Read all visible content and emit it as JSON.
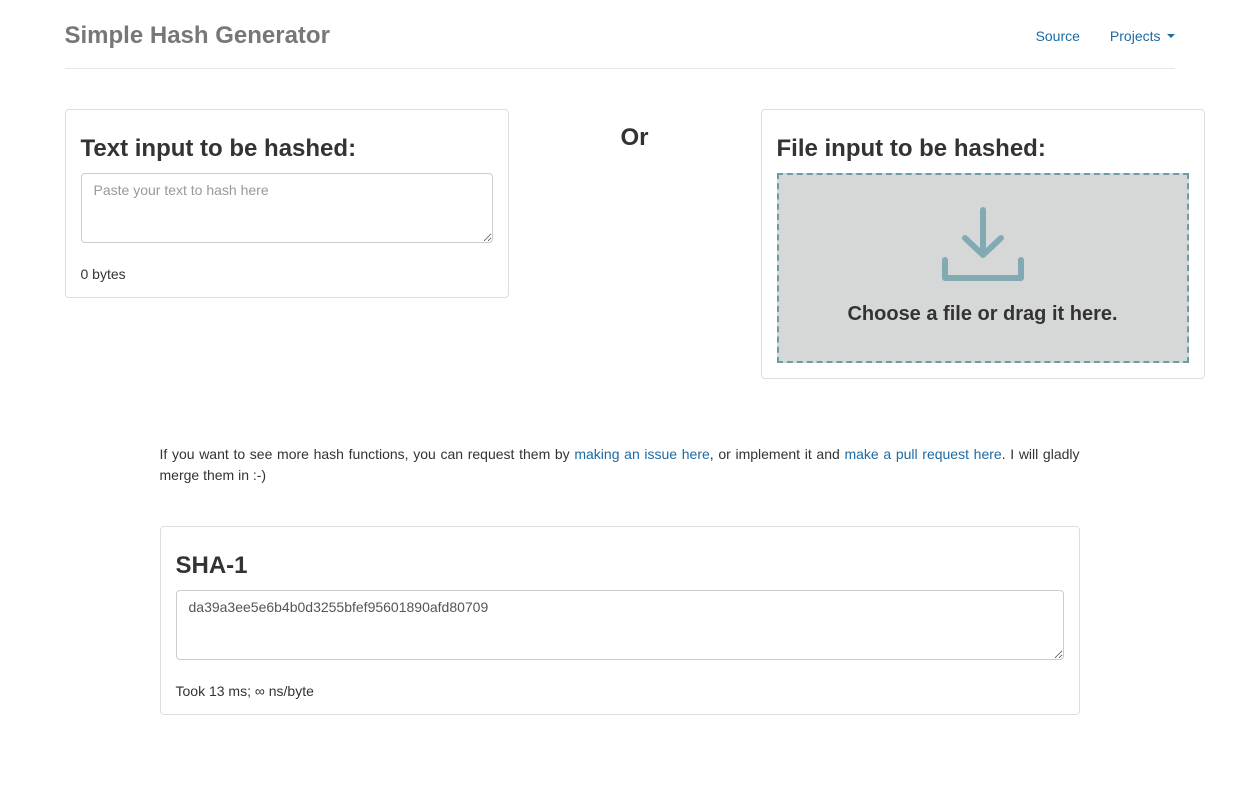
{
  "nav": {
    "brand": "Simple Hash Generator",
    "source": "Source",
    "projects": "Projects"
  },
  "inputs": {
    "text_heading": "Text input to be hashed:",
    "text_placeholder": "Paste your text to hash here",
    "text_value": "",
    "bytes_label": "0 bytes",
    "or_label": "Or",
    "file_heading": "File input to be hashed:",
    "dropzone_text": "Choose a file or drag it here."
  },
  "info": {
    "part1": "If you want to see more hash functions, you can request them by ",
    "link1": "making an issue here",
    "part2": ", or implement it and ",
    "link2": "make a pull request here",
    "part3": ". I will gladly merge them in :-)"
  },
  "result": {
    "algo": "SHA-1",
    "hash": "da39a3ee5e6b4b0d3255bfef95601890afd80709",
    "timing": "Took 13 ms; ∞ ns/byte"
  }
}
